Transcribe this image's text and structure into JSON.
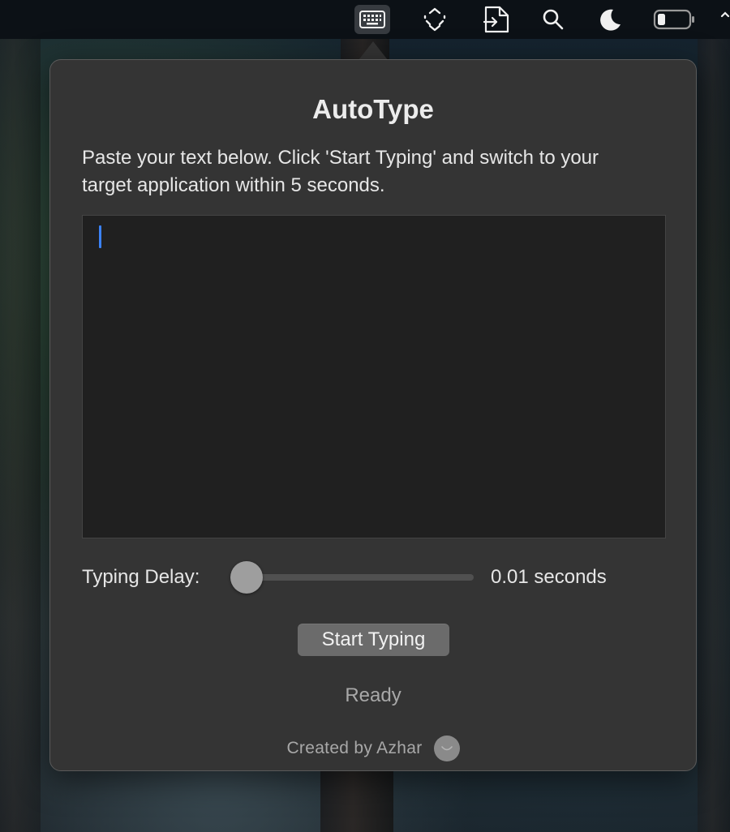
{
  "menubar": {
    "icons": [
      "keyboard-icon",
      "scan-frame-icon",
      "document-export-icon",
      "search-icon",
      "moon-icon",
      "battery-icon",
      "partial-icon"
    ],
    "active_icon": "keyboard-icon"
  },
  "app": {
    "title": "AutoType",
    "instructions": "Paste your text below. Click 'Start Typing' and switch to your target application within 5 seconds.",
    "text_input": {
      "value": "",
      "placeholder": ""
    },
    "typing_delay": {
      "label": "Typing Delay:",
      "value_text": "0.01 seconds",
      "slider_fraction": 0.0
    },
    "start_button": "Start Typing",
    "status": "Ready",
    "credit": "Created by Azhar"
  },
  "colors": {
    "caret": "#3b82f6",
    "popover_bg": "#343434",
    "textarea_bg": "#202020",
    "button_bg": "#6b6b6b"
  }
}
